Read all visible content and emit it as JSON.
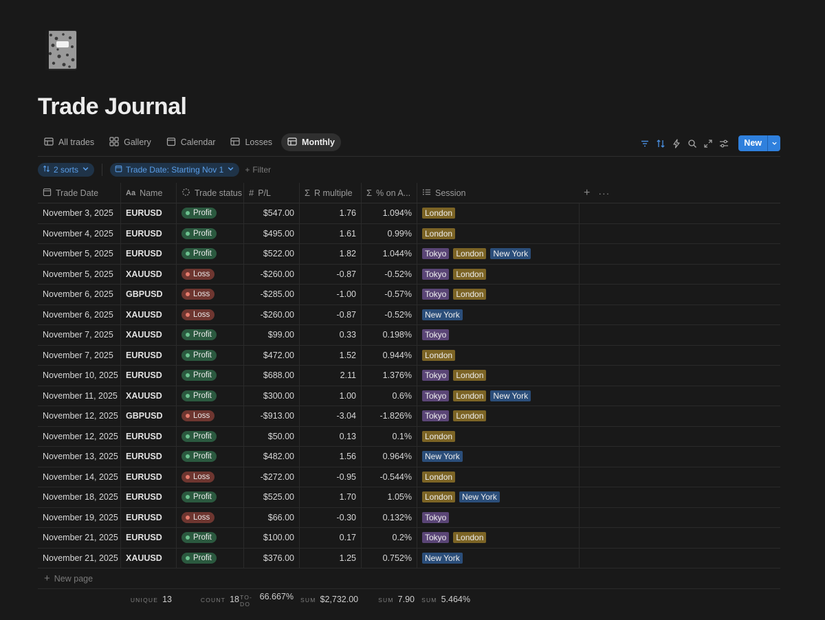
{
  "page": {
    "title": "Trade Journal"
  },
  "cover_icon": "notebook-icon",
  "tabs": [
    {
      "label": "All trades",
      "icon": "table-icon",
      "active": false
    },
    {
      "label": "Gallery",
      "icon": "gallery-icon",
      "active": false
    },
    {
      "label": "Calendar",
      "icon": "calendar-icon",
      "active": false
    },
    {
      "label": "Losses",
      "icon": "table-icon",
      "active": false
    },
    {
      "label": "Monthly",
      "icon": "table-icon",
      "active": true
    }
  ],
  "toolbar": {
    "new_label": "New"
  },
  "filters": {
    "sorts_label": "2 sorts",
    "date_filter_label": "Trade Date: Starting Nov 1",
    "add_filter_label": "Filter"
  },
  "columns": {
    "date": "Trade Date",
    "name": "Name",
    "status": "Trade status",
    "pl": "P/L",
    "r": "R multiple",
    "pct": "% on A...",
    "session": "Session"
  },
  "rows": [
    {
      "date": "November 3, 2025",
      "name": "EURUSD",
      "status": "Profit",
      "pl": "$547.00",
      "r": "1.76",
      "pct": "1.094%",
      "sessions": [
        "London"
      ]
    },
    {
      "date": "November 4, 2025",
      "name": "EURUSD",
      "status": "Profit",
      "pl": "$495.00",
      "r": "1.61",
      "pct": "0.99%",
      "sessions": [
        "London"
      ]
    },
    {
      "date": "November 5, 2025",
      "name": "EURUSD",
      "status": "Profit",
      "pl": "$522.00",
      "r": "1.82",
      "pct": "1.044%",
      "sessions": [
        "Tokyo",
        "London",
        "New York"
      ]
    },
    {
      "date": "November 5, 2025",
      "name": "XAUUSD",
      "status": "Loss",
      "pl": "-$260.00",
      "r": "-0.87",
      "pct": "-0.52%",
      "sessions": [
        "Tokyo",
        "London"
      ]
    },
    {
      "date": "November 6, 2025",
      "name": "GBPUSD",
      "status": "Loss",
      "pl": "-$285.00",
      "r": "-1.00",
      "pct": "-0.57%",
      "sessions": [
        "Tokyo",
        "London"
      ]
    },
    {
      "date": "November 6, 2025",
      "name": "XAUUSD",
      "status": "Loss",
      "pl": "-$260.00",
      "r": "-0.87",
      "pct": "-0.52%",
      "sessions": [
        "New York"
      ]
    },
    {
      "date": "November 7, 2025",
      "name": "XAUUSD",
      "status": "Profit",
      "pl": "$99.00",
      "r": "0.33",
      "pct": "0.198%",
      "sessions": [
        "Tokyo"
      ]
    },
    {
      "date": "November 7, 2025",
      "name": "EURUSD",
      "status": "Profit",
      "pl": "$472.00",
      "r": "1.52",
      "pct": "0.944%",
      "sessions": [
        "London"
      ]
    },
    {
      "date": "November 10, 2025",
      "name": "EURUSD",
      "status": "Profit",
      "pl": "$688.00",
      "r": "2.11",
      "pct": "1.376%",
      "sessions": [
        "Tokyo",
        "London"
      ]
    },
    {
      "date": "November 11, 2025",
      "name": "XAUUSD",
      "status": "Profit",
      "pl": "$300.00",
      "r": "1.00",
      "pct": "0.6%",
      "sessions": [
        "Tokyo",
        "London",
        "New York"
      ]
    },
    {
      "date": "November 12, 2025",
      "name": "GBPUSD",
      "status": "Loss",
      "pl": "-$913.00",
      "r": "-3.04",
      "pct": "-1.826%",
      "sessions": [
        "Tokyo",
        "London"
      ]
    },
    {
      "date": "November 12, 2025",
      "name": "EURUSD",
      "status": "Profit",
      "pl": "$50.00",
      "r": "0.13",
      "pct": "0.1%",
      "sessions": [
        "London"
      ]
    },
    {
      "date": "November 13, 2025",
      "name": "EURUSD",
      "status": "Profit",
      "pl": "$482.00",
      "r": "1.56",
      "pct": "0.964%",
      "sessions": [
        "New York"
      ]
    },
    {
      "date": "November 14, 2025",
      "name": "EURUSD",
      "status": "Loss",
      "pl": "-$272.00",
      "r": "-0.95",
      "pct": "-0.544%",
      "sessions": [
        "London"
      ]
    },
    {
      "date": "November 18, 2025",
      "name": "EURUSD",
      "status": "Profit",
      "pl": "$525.00",
      "r": "1.70",
      "pct": "1.05%",
      "sessions": [
        "London",
        "New York"
      ]
    },
    {
      "date": "November 19, 2025",
      "name": "EURUSD",
      "status": "Loss",
      "pl": "$66.00",
      "r": "-0.30",
      "pct": "0.132%",
      "sessions": [
        "Tokyo"
      ]
    },
    {
      "date": "November 21, 2025",
      "name": "EURUSD",
      "status": "Profit",
      "pl": "$100.00",
      "r": "0.17",
      "pct": "0.2%",
      "sessions": [
        "Tokyo",
        "London"
      ]
    },
    {
      "date": "November 21, 2025",
      "name": "XAUUSD",
      "status": "Profit",
      "pl": "$376.00",
      "r": "1.25",
      "pct": "0.752%",
      "sessions": [
        "New York"
      ]
    }
  ],
  "new_page_label": "New page",
  "footer": {
    "name": {
      "label": "UNIQUE",
      "value": "13"
    },
    "status": {
      "label": "COUNT",
      "value": "18"
    },
    "pl": {
      "label": "TO-DO",
      "value": "66.667%"
    },
    "pl_sum": {
      "label": "SUM",
      "value": "$2,732.00"
    },
    "r": {
      "label": "SUM",
      "value": "7.90"
    },
    "pct": {
      "label": "SUM",
      "value": "5.464%"
    }
  },
  "colors": {
    "background": "#191919",
    "accent": "#2f80dd",
    "profit": "#2b593f",
    "loss": "#6e3630",
    "tokyo": "#5a4576",
    "london": "#7c6425",
    "new_york": "#2b4e7a"
  }
}
